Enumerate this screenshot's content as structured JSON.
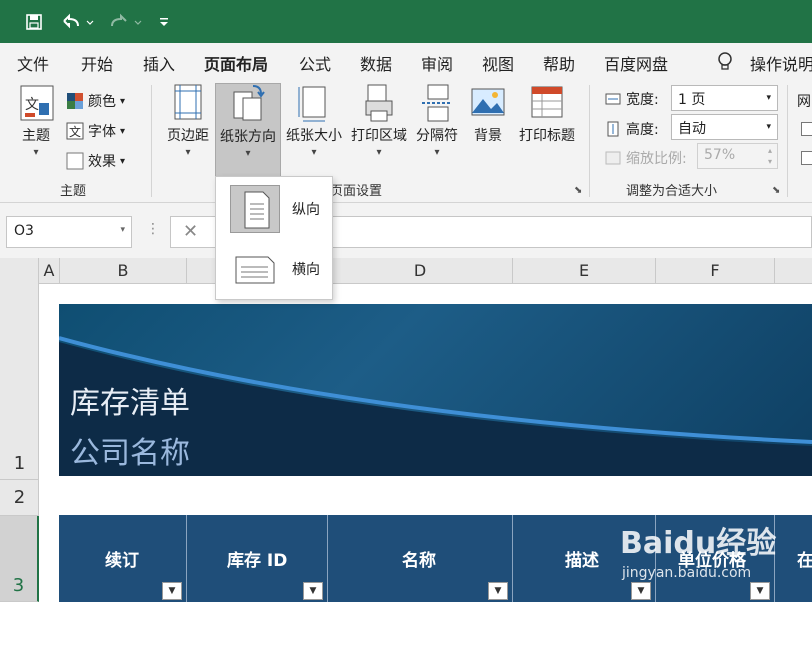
{
  "quick_access": {
    "save_icon": "save-icon",
    "undo_icon": "undo-icon",
    "redo_icon": "redo-icon",
    "customize_icon": "customize-icon"
  },
  "tabs": [
    "文件",
    "开始",
    "插入",
    "页面布局",
    "公式",
    "数据",
    "审阅",
    "视图",
    "帮助",
    "百度网盘"
  ],
  "active_tab": "页面布局",
  "tell_me": "操作说明",
  "ribbon": {
    "themes": {
      "theme_label": "主题",
      "colors_label": "颜色",
      "fonts_label": "字体",
      "effects_label": "效果",
      "group_label": "主题"
    },
    "page_setup": {
      "margins": "页边距",
      "orientation": "纸张方向",
      "size": "纸张大小",
      "print_area": "打印区域",
      "breaks": "分隔符",
      "background": "背景",
      "print_titles": "打印标题",
      "group_label": "页面设置"
    },
    "scale_to_fit": {
      "width_label": "宽度:",
      "width_value": "1 页",
      "height_label": "高度:",
      "height_value": "自动",
      "scale_label": "缩放比例:",
      "scale_value": "57%",
      "group_label": "调整为合适大小"
    },
    "sheet_options_partial": "网"
  },
  "orientation_menu": {
    "portrait": "纵向",
    "landscape": "横向",
    "selected": "纵向"
  },
  "name_box": "O3",
  "columns": [
    "A",
    "B",
    "C",
    "D",
    "E",
    "F"
  ],
  "rows": [
    "1",
    "2",
    "3"
  ],
  "banner": {
    "title": "库存清单",
    "company": "公司名称"
  },
  "table_headers": [
    "续订",
    "库存 ID",
    "名称",
    "描述",
    "单位价格",
    "在"
  ],
  "watermark": {
    "logo": "Baidu经验",
    "url": "jingyan.baidu.com"
  }
}
